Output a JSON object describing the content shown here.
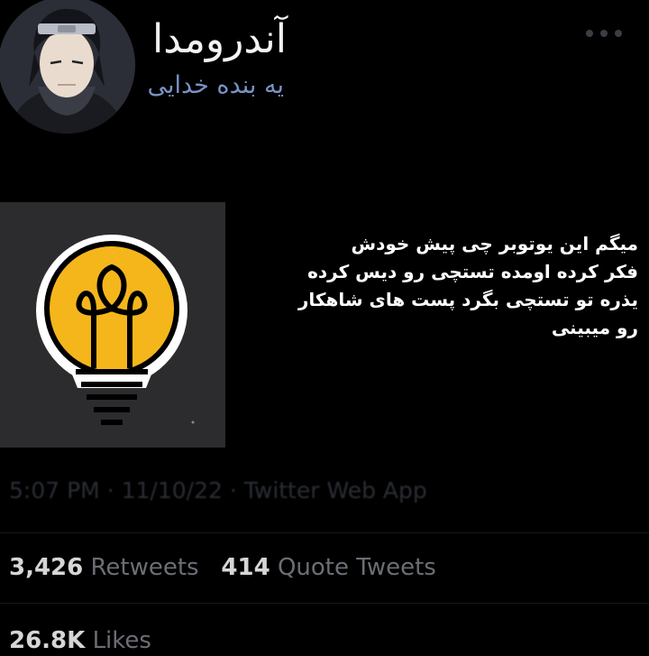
{
  "profile": {
    "display_name": "آندرومدا",
    "handle": "یه بنده خدایی"
  },
  "tweet": {
    "lines": [
      "میگم این یوتوبر چی پیش خودش",
      "فکر کرده اومده تستچی رو دیس کرده",
      "یذره تو تستچی بگرد پست های شاهکار",
      "رو میبینی"
    ],
    "meta_time": "5:07 PM",
    "meta_date": "11/10/22",
    "meta_source": "Twitter Web App"
  },
  "stats": {
    "retweets_count": "3,426",
    "retweets_label": "Retweets",
    "quotes_count": "414",
    "quotes_label": "Quote Tweets",
    "likes_count": "26.8K",
    "likes_label": "Likes"
  },
  "colors": {
    "background": "#000000",
    "handle": "#7a93c4",
    "bulb_yellow": "#f5b61c",
    "media_bg": "#2c2c2e"
  },
  "icons": {
    "more": "more-horizontal-icon",
    "media": "lightbulb-logo"
  }
}
